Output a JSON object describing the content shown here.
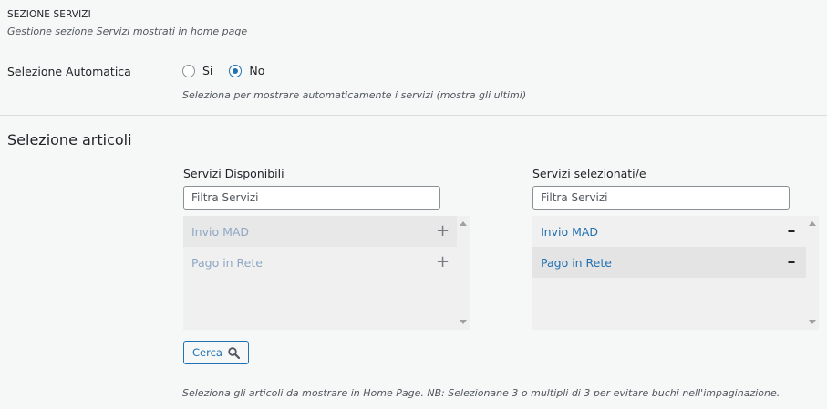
{
  "section": {
    "title": "SEZIONE SERVIZI",
    "description": "Gestione sezione Servizi mostrati in home page"
  },
  "auto_selection": {
    "label": "Selezione Automatica",
    "options": [
      {
        "label": "Si",
        "checked": false
      },
      {
        "label": "No",
        "checked": true
      }
    ],
    "hint": "Seleziona per mostrare automaticamente i servizi (mostra gli ultimi)"
  },
  "articles": {
    "title": "Selezione articoli",
    "available": {
      "title": "Servizi Disponibili",
      "filter_placeholder": "Filtra Servizi",
      "items": [
        {
          "label": "Invio MAD",
          "icon": "plus-icon"
        },
        {
          "label": "Pago in Rete",
          "icon": "plus-icon"
        }
      ]
    },
    "selected": {
      "title": "Servizi selezionati/e",
      "filter_placeholder": "Filtra Servizi",
      "items": [
        {
          "label": "Invio MAD",
          "icon": "minus-icon"
        },
        {
          "label": "Pago in Rete",
          "icon": "minus-icon"
        }
      ]
    },
    "search_button": "Cerca",
    "hint": "Seleziona gli articoli da mostrare in Home Page. NB: Selezionane 3 o multipli di 3 per evitare buchi nell'impaginazione."
  },
  "colors": {
    "accent": "#2271b1",
    "available_item": "#8ea8c3",
    "background": "#f6f7f7"
  }
}
